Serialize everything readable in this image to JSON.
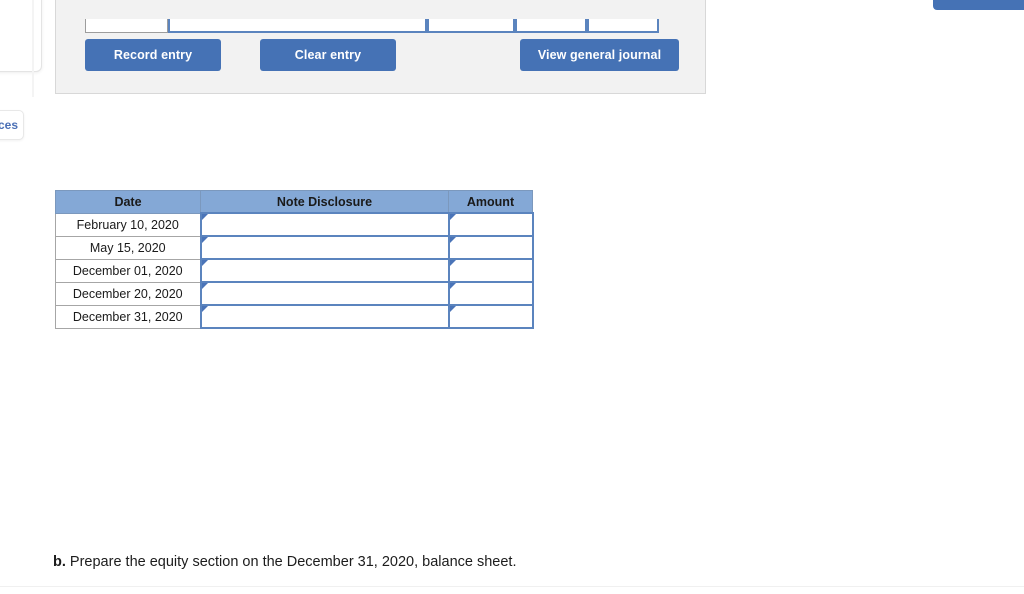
{
  "left_fragment": {
    "references_label": "ces"
  },
  "top_right_button": {
    "label": ""
  },
  "journal_form": {
    "buttons": {
      "record_entry": "Record entry",
      "clear_entry": "Clear entry",
      "view_general_journal": "View general journal"
    }
  },
  "disclosure_table": {
    "headers": [
      "Date",
      "Note Disclosure",
      "Amount"
    ],
    "rows": [
      {
        "date": "February 10, 2020",
        "note_disclosure": "",
        "amount": ""
      },
      {
        "date": "May 15, 2020",
        "note_disclosure": "",
        "amount": ""
      },
      {
        "date": "December 01, 2020",
        "note_disclosure": "",
        "amount": ""
      },
      {
        "date": "December 20, 2020",
        "note_disclosure": "",
        "amount": ""
      },
      {
        "date": "December 31, 2020",
        "note_disclosure": "",
        "amount": ""
      }
    ]
  },
  "prompt": {
    "part_label": "b.",
    "text": "Prepare the equity section on the December 31, 2020, balance sheet."
  },
  "colors": {
    "button_blue": "#4572b5",
    "table_header_blue": "#84a8d6",
    "input_border_blue": "#5b84be",
    "panel_grey": "#f2f2f2"
  }
}
